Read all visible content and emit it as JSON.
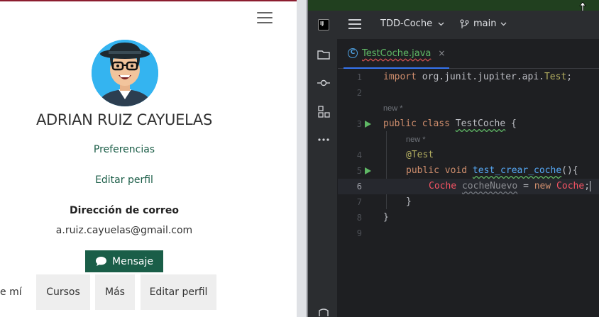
{
  "profile": {
    "name": "ADRIAN RUIZ CAYUELAS",
    "preferences_link": "Preferencias",
    "edit_profile_link": "Editar perfil",
    "email_label": "Dirección de correo",
    "email_value": "a.ruiz.cayuelas@gmail.com",
    "message_button": "Mensaje",
    "tabs": [
      "e mí",
      "Cursos",
      "Más",
      "Editar perfil"
    ],
    "accent_color": "#1a5e48"
  },
  "ide": {
    "logo": "IJ",
    "project_name": "TDD-Coche",
    "branch_name": "main",
    "file_tab": "TestCoche.java",
    "file_tab_close": "×",
    "hints": [
      "new *",
      "new *"
    ],
    "line_numbers": [
      "1",
      "2",
      "3",
      "4",
      "5",
      "6",
      "7",
      "8",
      "9"
    ],
    "code": {
      "l1_kw": "import",
      "l1_rest": " org.junit.jupiter.api.",
      "l1_test": "Test",
      "l1_semi": ";",
      "l3_kw": "public class",
      "l3_cls": "TestCoche",
      "l3_brace": " {",
      "l4_ann": "@Test",
      "l5_kw": "public void",
      "l5_fn": "test_crear_coche",
      "l5_rest": "(){",
      "l6_type": "Coche",
      "l6_var": "cocheNuevo",
      "l6_eq": " = ",
      "l6_new": "new",
      "l6_ctor": "Coche",
      "l6_semi": ";",
      "l7_brace": "}",
      "l8_brace": "}"
    },
    "colors": {
      "keyword": "#cf8e6d",
      "function": "#56a8f5",
      "error": "#f75464",
      "annotation": "#b3ae60"
    },
    "tool_icons": [
      "folder-icon",
      "commit-icon",
      "structure-icon",
      "more-icon"
    ]
  }
}
